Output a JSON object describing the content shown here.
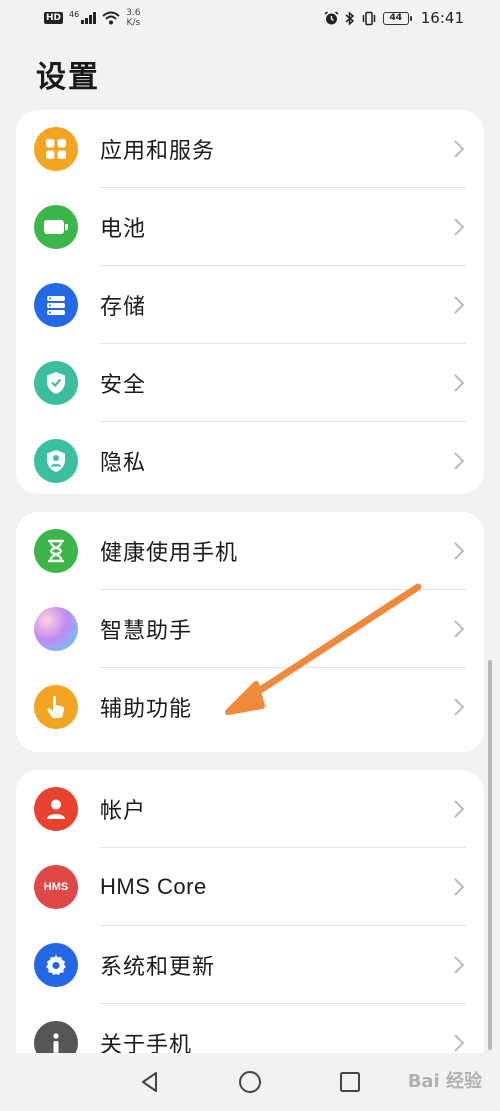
{
  "status_bar": {
    "hd": "HD",
    "network": "46",
    "speed_value": "3.6",
    "speed_unit": "K/s",
    "battery": "44",
    "time": "16:41"
  },
  "page": {
    "title": "设置"
  },
  "groups": [
    {
      "items": [
        {
          "label": "应用和服务",
          "icon": "apps-icon",
          "color": "#f3a423"
        },
        {
          "label": "电池",
          "icon": "battery-icon",
          "color": "#3cb54a"
        },
        {
          "label": "存储",
          "icon": "storage-icon",
          "color": "#2468e5"
        },
        {
          "label": "安全",
          "icon": "shield-icon",
          "color": "#3bbf9e"
        },
        {
          "label": "隐私",
          "icon": "privacy-icon",
          "color": "#3bbf9e"
        }
      ]
    },
    {
      "items": [
        {
          "label": "健康使用手机",
          "icon": "hourglass-icon",
          "color": "#3cb54a"
        },
        {
          "label": "智慧助手",
          "icon": "assistant-icon",
          "color": "#c28bf0"
        },
        {
          "label": "辅助功能",
          "icon": "hand-icon",
          "color": "#f3a423"
        }
      ]
    },
    {
      "items": [
        {
          "label": "帐户",
          "icon": "account-icon",
          "color": "#e8432f"
        },
        {
          "label": "HMS Core",
          "icon": "hms-icon",
          "color": "#e04848",
          "icon_text": "HMS"
        },
        {
          "label": "系统和更新",
          "icon": "settings-gear-icon",
          "color": "#2468e5"
        },
        {
          "label": "关于手机",
          "icon": "info-icon",
          "color": "#555555"
        }
      ]
    }
  ],
  "watermark": "Bai 经验",
  "annotation_color": "#f08a3a"
}
